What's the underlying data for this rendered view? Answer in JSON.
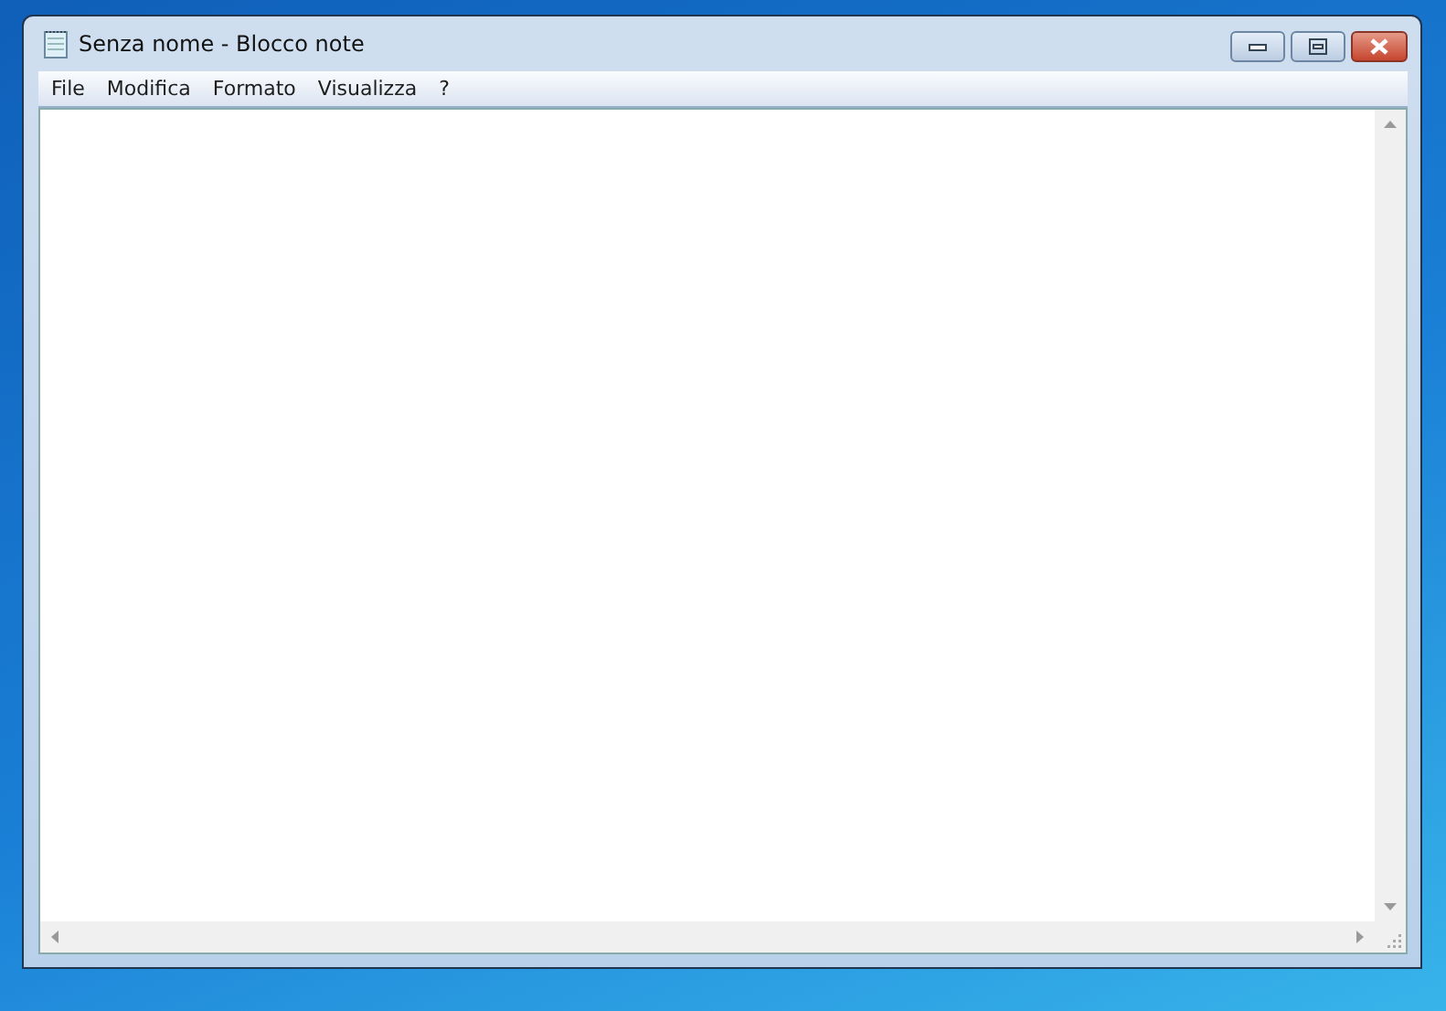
{
  "window": {
    "title": "Senza nome - Blocco note"
  },
  "menu": [
    {
      "label": "File"
    },
    {
      "label": "Modifica"
    },
    {
      "label": "Formato"
    },
    {
      "label": "Visualizza"
    },
    {
      "label": "?"
    }
  ]
}
